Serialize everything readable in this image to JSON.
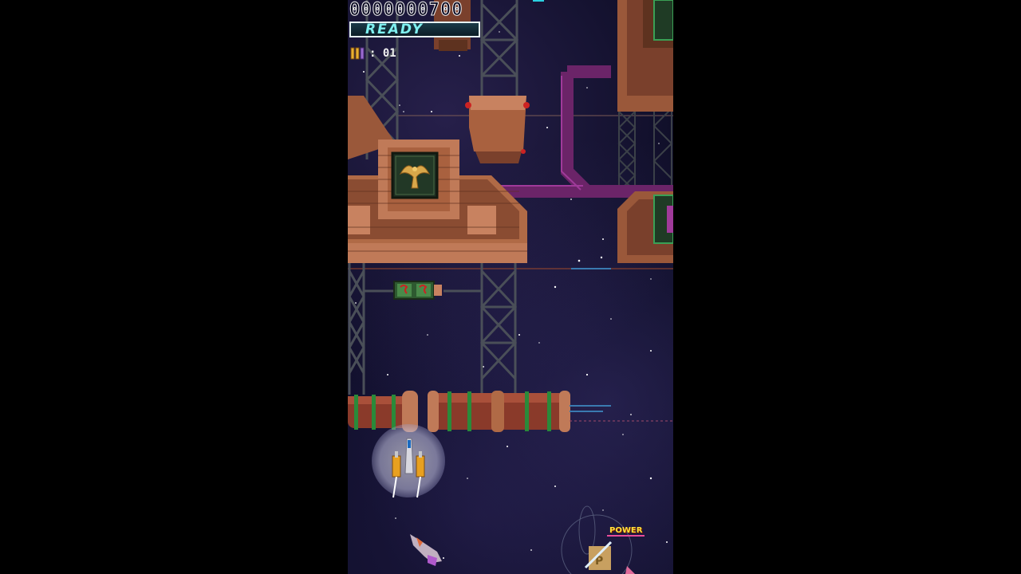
{
  "hud": {
    "score": "0000000700",
    "status": "READY",
    "bomb_count": ": 01"
  },
  "pickup": {
    "label": "POWER"
  },
  "colors": {
    "background": "#0b0b22",
    "brick": "#b06a46",
    "girder": "#4a4f58",
    "pipe_magenta": "#7c2a78",
    "hud_cyan": "#7ff0f0",
    "power_yellow": "#ffe23a"
  },
  "icons": [
    "bomb-icon",
    "eagle-emblem-icon",
    "player-ship-icon",
    "power-item-icon",
    "enemy-fighter-icon"
  ]
}
